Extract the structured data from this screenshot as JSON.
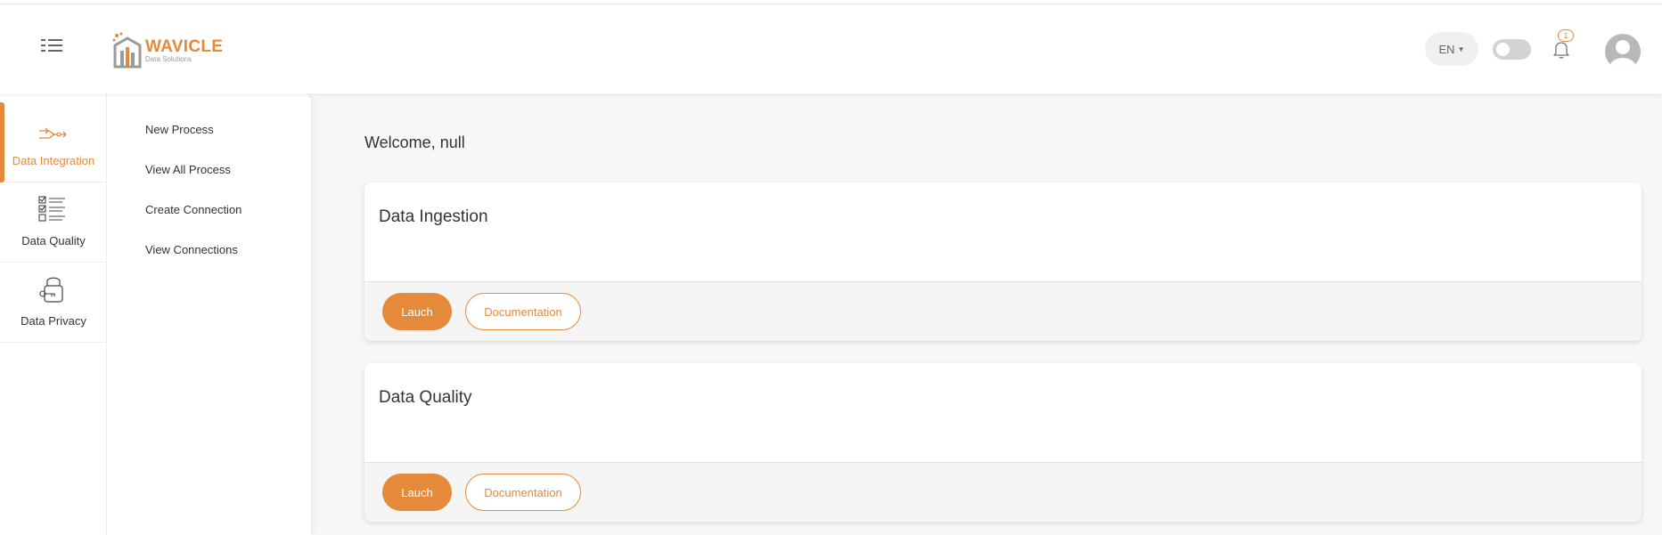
{
  "brand": {
    "logo_title": "WAVICLE",
    "logo_subtitle": "Data Solutions",
    "accent_color": "#e5893b"
  },
  "header": {
    "menu_icon": "list-menu-icon",
    "language": "EN",
    "theme_toggle": "off",
    "notification_count": "1",
    "notification_icon": "bell-icon",
    "avatar_icon": "user-avatar-icon"
  },
  "sidebar": {
    "items": [
      {
        "label": "Data Integration",
        "icon": "integration-arrows-icon",
        "active": true
      },
      {
        "label": "Data Quality",
        "icon": "checklist-icon",
        "active": false
      },
      {
        "label": "Data Privacy",
        "icon": "padlock-key-icon",
        "active": false
      }
    ]
  },
  "submenu": {
    "items": [
      {
        "label": "New Process"
      },
      {
        "label": "View All Process"
      },
      {
        "label": "Create Connection"
      },
      {
        "label": "View Connections"
      }
    ]
  },
  "main": {
    "welcome": "Welcome, null",
    "cards": [
      {
        "title": "Data Ingestion",
        "launch_label": "Lauch",
        "doc_label": "Documentation"
      },
      {
        "title": "Data Quality",
        "launch_label": "Lauch",
        "doc_label": "Documentation"
      }
    ]
  }
}
